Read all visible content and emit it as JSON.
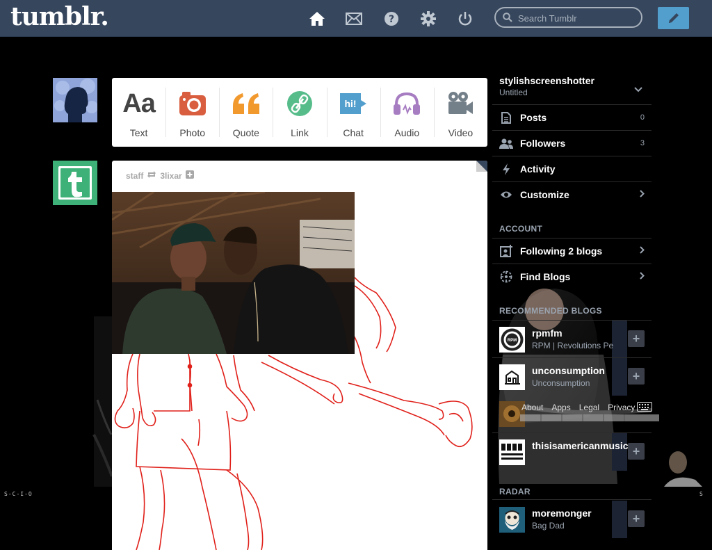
{
  "header": {
    "logo": "tumblr.",
    "search_placeholder": "Search Tumblr",
    "icons": [
      "home-icon",
      "inbox-icon",
      "help-icon",
      "settings-icon",
      "logout-icon"
    ]
  },
  "post_types": [
    {
      "id": "text",
      "label": "Text",
      "glyph": "Aa",
      "color": "#444444"
    },
    {
      "id": "photo",
      "label": "Photo",
      "color": "#d95e40"
    },
    {
      "id": "quote",
      "label": "Quote",
      "glyph": "““",
      "color": "#f2992e"
    },
    {
      "id": "link",
      "label": "Link",
      "color": "#56bc8a"
    },
    {
      "id": "chat",
      "label": "Chat",
      "glyph": "hi!",
      "color": "#529ecc"
    },
    {
      "id": "audio",
      "label": "Audio",
      "color": "#a77dc2"
    },
    {
      "id": "video",
      "label": "Video",
      "color": "#748089"
    }
  ],
  "post": {
    "author": "staff",
    "reblogged_from": "3lixar"
  },
  "sidebar": {
    "blog_name": "stylishscreenshotter",
    "blog_subtitle": "Untitled",
    "rows": [
      {
        "label": "Posts",
        "count": "0"
      },
      {
        "label": "Followers",
        "count": "3"
      },
      {
        "label": "Activity"
      },
      {
        "label": "Customize"
      }
    ],
    "account_title": "ACCOUNT",
    "account_rows": [
      {
        "label": "Following 2 blogs"
      },
      {
        "label": "Find Blogs"
      }
    ],
    "recommended_title": "RECOMMENDED BLOGS",
    "recommended": [
      {
        "name": "rpmfm",
        "subtitle": "RPM | Revolutions Pe"
      },
      {
        "name": "unconsumption",
        "subtitle": "Unconsumption"
      },
      {
        "name": "thisisamericanmusic",
        "subtitle": ""
      }
    ],
    "footer_links": [
      "About",
      "Apps",
      "Legal",
      "Privacy"
    ],
    "radar_title": "RADAR",
    "radar": {
      "name": "moremonger",
      "subtitle": "Bag Dad"
    }
  },
  "backdrop_text": {
    "left": "S-C-I-O",
    "right": "S"
  },
  "colors": {
    "header": "#36465d",
    "compose": "#529ecc",
    "staff_avatar": "#3eb178",
    "doodle": "#e0201a"
  }
}
